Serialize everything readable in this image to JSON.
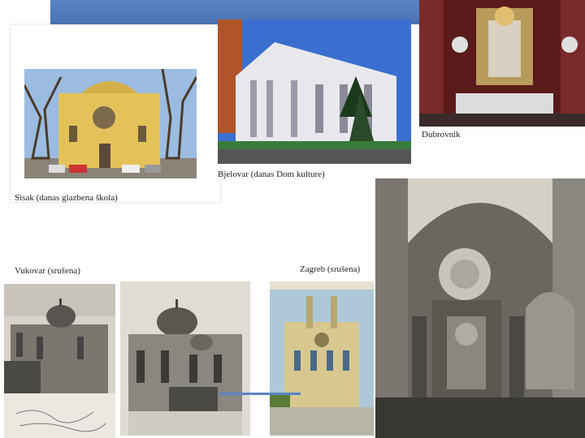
{
  "slide": {
    "accent_color": "#5b84c4",
    "captions": {
      "sisak": "Sisak (danas glazbena škola)",
      "bjelovar": "Bjelovar (danas Dom kulture)",
      "dubrovnik": "Dubrovnik",
      "vukovar": "Vukovar (srušena)",
      "zagreb": "Zagreb (srušena)"
    }
  }
}
